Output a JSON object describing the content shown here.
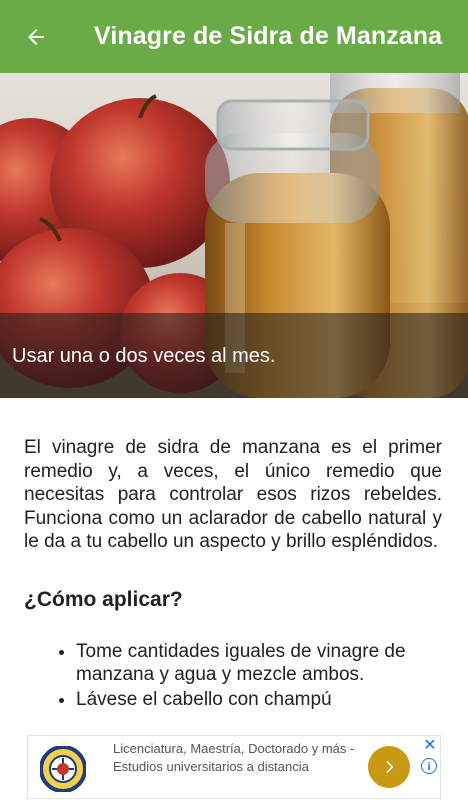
{
  "appbar": {
    "title": "Vinagre de Sidra de Manzana",
    "back_icon": "arrow-left-icon",
    "background": "#6aab47"
  },
  "hero": {
    "caption": "Usar una o dos veces al mes."
  },
  "article": {
    "paragraph": "El vinagre de sidra de manzana es el primer remedio y, a veces, el único remedio que necesitas para controlar esos rizos rebeldes. Funciona como un aclarador de cabello natural y le da a tu cabello un aspecto y brillo espléndidos.",
    "heading": "¿Cómo aplicar?",
    "steps": [
      "Tome cantidades iguales de vinagre de manzana y agua y mezcle ambos.",
      "Lávese el cabello con champú"
    ]
  },
  "ad": {
    "text": "Licenciatura, Maestría, Doctorado y más - Estudios universitarios a distancia",
    "go_icon": "chevron-right-icon",
    "close_icon": "close-icon",
    "info_icon": "info-icon",
    "info_glyph": "i",
    "close_glyph": "✕",
    "accent": "#c89a14"
  }
}
